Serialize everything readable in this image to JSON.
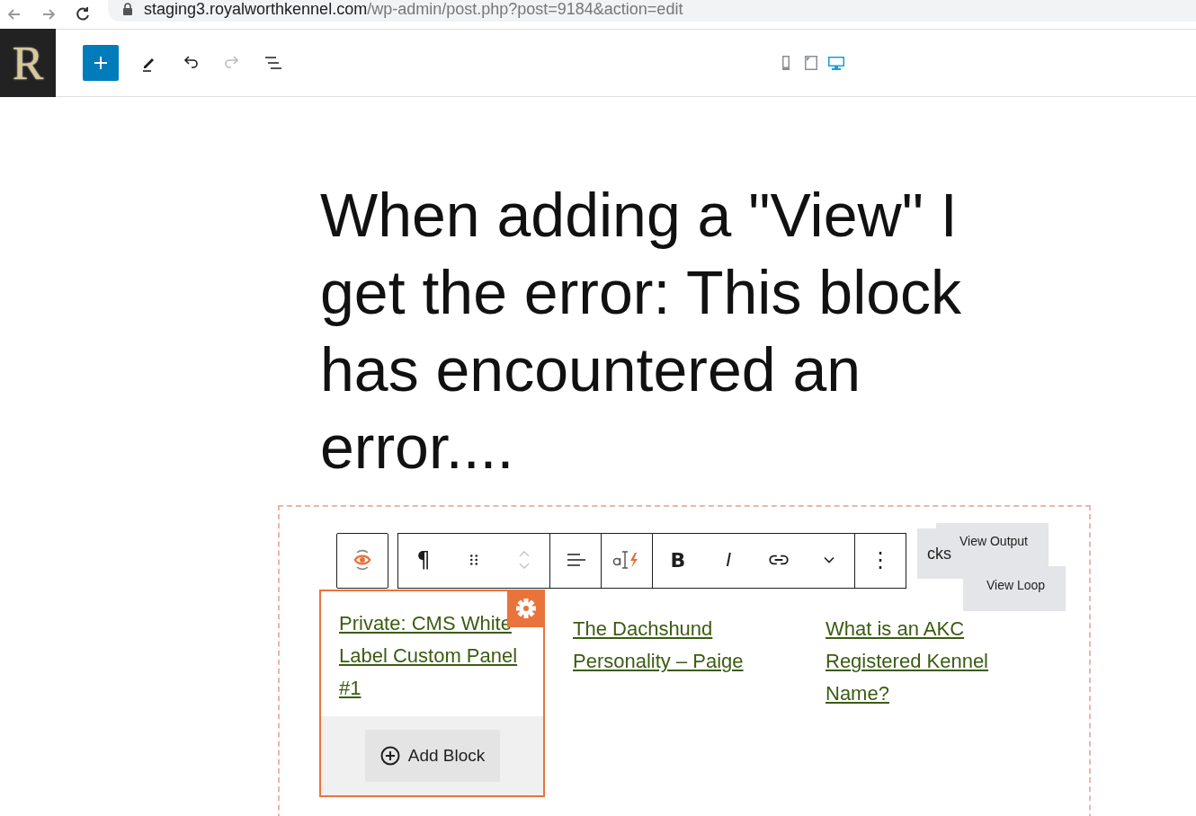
{
  "browser": {
    "url_host": "staging3.royalworthkennel.com",
    "url_path": "/wp-admin/post.php?post=9184&action=edit"
  },
  "logo": {
    "letter": "R"
  },
  "header_tools": [
    {
      "kind": "add"
    },
    {
      "kind": "edit"
    },
    {
      "kind": "undo",
      "disabled": false
    },
    {
      "kind": "redo",
      "disabled": true
    },
    {
      "kind": "outline"
    }
  ],
  "devices": [
    {
      "kind": "mobile",
      "selected": false
    },
    {
      "kind": "tablet",
      "selected": false
    },
    {
      "kind": "desktop",
      "selected": true
    }
  ],
  "title": "When adding a \"View\" I get the error: This block has encountered an error....",
  "block_toolbar": {
    "groups": [
      [
        {
          "kind": "transform"
        }
      ],
      [
        {
          "kind": "paragraph",
          "glyph": "¶"
        },
        {
          "kind": "drag"
        },
        {
          "kind": "mover"
        }
      ],
      [
        {
          "kind": "align"
        }
      ],
      [
        {
          "kind": "highlight"
        }
      ],
      [
        {
          "kind": "bold",
          "glyph": "B"
        },
        {
          "kind": "italic",
          "glyph": "I"
        },
        {
          "kind": "link"
        },
        {
          "kind": "more-rich"
        }
      ],
      [
        {
          "kind": "options",
          "glyph": "⋮"
        }
      ]
    ]
  },
  "hidden_tab": {
    "label": "cks"
  },
  "view_tabs": [
    {
      "label": "View Output"
    },
    {
      "label": "View Loop"
    }
  ],
  "columns": [
    {
      "title": "Private: CMS White Label Custom Panel #1",
      "selected": true,
      "button": "Add Block"
    },
    {
      "title": "The Dachshund Personality – Paige",
      "selected": false
    },
    {
      "title": "What is an AKC Registered Kennel Name?",
      "selected": false
    }
  ]
}
